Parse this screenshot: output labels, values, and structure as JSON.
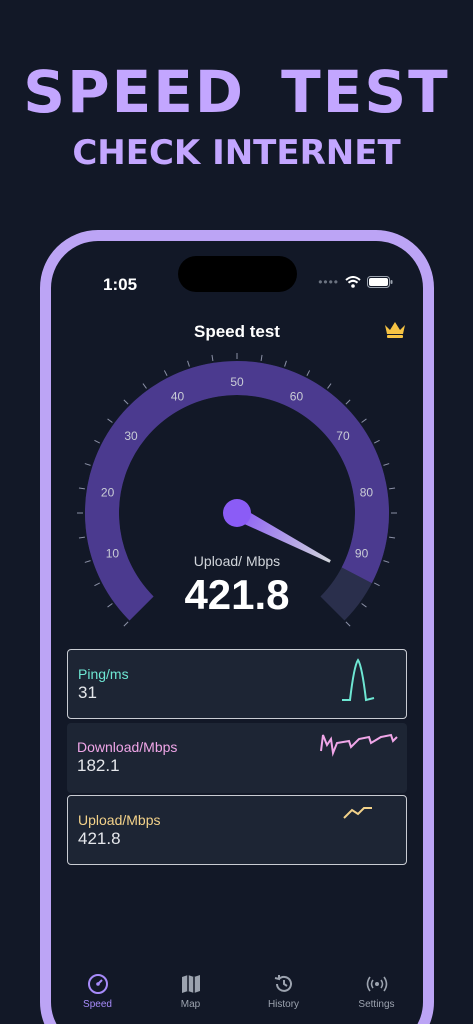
{
  "promo": {
    "title": "SPEED  TEST",
    "subtitle": "CHECK INTERNET"
  },
  "status_bar": {
    "time": "1:05"
  },
  "header": {
    "title": "Speed test",
    "premium_icon": "crown-icon"
  },
  "gauge": {
    "caption": "Upload/ Mbps",
    "value": "421.8",
    "level": 0.935,
    "ticks": [
      "10",
      "20",
      "30",
      "40",
      "50",
      "60",
      "70",
      "80",
      "90"
    ],
    "colors": {
      "track": "#2a2f4c",
      "fill": "#4b3a8f",
      "needle": "#8b5cf6"
    }
  },
  "metrics": [
    {
      "label": "Ping/ms",
      "value": "31",
      "color": "#6ee7d3"
    },
    {
      "label": "Download/Mbps",
      "value": "182.1",
      "color": "#f0a6e8"
    },
    {
      "label": "Upload/Mbps",
      "value": "421.8",
      "color": "#f3d28a"
    }
  ],
  "tabs": [
    {
      "label": "Speed",
      "icon": "speedometer-icon",
      "active": true
    },
    {
      "label": "Map",
      "icon": "map-icon",
      "active": false
    },
    {
      "label": "History",
      "icon": "history-icon",
      "active": false
    },
    {
      "label": "Settings",
      "icon": "signal-icon",
      "active": false
    }
  ]
}
